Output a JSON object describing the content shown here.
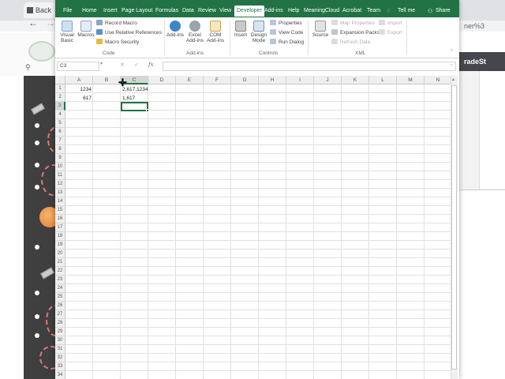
{
  "browser": {
    "tab_title": "Back",
    "address_fragment": "ner%3",
    "right_panel_text": "radeSt"
  },
  "ribbon": {
    "tabs": [
      "File",
      "Home",
      "Insert",
      "Page Layout",
      "Formulas",
      "Data",
      "Review",
      "View",
      "Developer",
      "Add-ins",
      "Help",
      "MeaningCloud",
      "Acrobat",
      "Team",
      "Tell me",
      "Share"
    ],
    "active_tab": "Developer",
    "groups": {
      "code": {
        "label": "Code",
        "visual_basic": "Visual Basic",
        "macros": "Macros",
        "record_macro": "Record Macro",
        "use_relative": "Use Relative References",
        "macro_security": "Macro Security"
      },
      "addins": {
        "label": "Add-ins",
        "addins": "Add-ins",
        "excel_addins": "Excel Add-ins",
        "com_addins": "COM Add-ins"
      },
      "controls": {
        "label": "Controls",
        "insert": "Insert",
        "design_mode": "Design Mode",
        "properties": "Properties",
        "view_code": "View Code",
        "run_dialog": "Run Dialog"
      },
      "xml": {
        "label": "XML",
        "source": "Source",
        "map_properties": "Map Properties",
        "expansion_packs": "Expansion Packs",
        "refresh_data": "Refresh Data",
        "import": "Import",
        "export": "Export"
      }
    }
  },
  "formula_bar": {
    "name_box": "C3",
    "fx": "fx",
    "cancel": "✕",
    "enter": "✓",
    "content": ""
  },
  "grid": {
    "columns": [
      "A",
      "B",
      "C",
      "D",
      "E",
      "F",
      "G",
      "H",
      "I",
      "J",
      "K",
      "L",
      "M",
      "N"
    ],
    "selected_column": "C",
    "selected_row": 3,
    "rows": [
      "1",
      "2",
      "3",
      "4",
      "5",
      "6",
      "7",
      "8",
      "9",
      "10",
      "11",
      "12",
      "13",
      "14",
      "15",
      "16",
      "17",
      "18",
      "19",
      "20",
      "21",
      "22",
      "23",
      "24",
      "25",
      "26",
      "27",
      "28",
      "29",
      "30",
      "31",
      "32",
      "33",
      "34"
    ],
    "cells": {
      "A1": "1234",
      "A2": "617",
      "C1": "2,617,1234",
      "C2": "1,617"
    }
  },
  "colors": {
    "excel_green": "#217346",
    "grid_line": "#e1e1e1",
    "left_band": "#3f3f3f"
  }
}
